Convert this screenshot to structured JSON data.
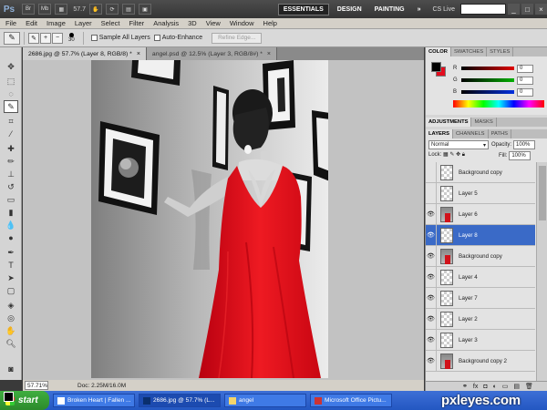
{
  "app": {
    "logo": "Ps",
    "bar_buttons": [
      "Br",
      "Mb"
    ],
    "zoom": "57.7",
    "workspaces": [
      "ESSENTIALS",
      "DESIGN",
      "PAINTING"
    ],
    "more": "»",
    "cs_live": "CS Live",
    "window_controls": [
      "_",
      "□",
      "×"
    ]
  },
  "menu": [
    "File",
    "Edit",
    "Image",
    "Layer",
    "Select",
    "Filter",
    "Analysis",
    "3D",
    "View",
    "Window",
    "Help"
  ],
  "options": {
    "brush_size": "30",
    "sample_all_layers": "Sample All Layers",
    "auto_enhance": "Auto-Enhance",
    "refine_edge": "Refine Edge..."
  },
  "documents": {
    "tabs": [
      {
        "label": "2686.jpg @ 57.7% (Layer 8, RGB/8) *",
        "close": "×"
      },
      {
        "label": "angel.psd @ 12.5% (Layer 3, RGB/8#) *",
        "close": "×"
      }
    ]
  },
  "status": {
    "zoom": "57.71%",
    "doc": "Doc: 2.25M/16.0M"
  },
  "color_panel": {
    "tabs": [
      "COLOR",
      "SWATCHES",
      "STYLES"
    ],
    "sliders": [
      {
        "label": "R",
        "value": "0",
        "color": "#e00000"
      },
      {
        "label": "G",
        "value": "0",
        "color": "#00b000"
      },
      {
        "label": "B",
        "value": "0",
        "color": "#0030e0"
      }
    ],
    "foreground": "#000000",
    "background": "#e40c1e"
  },
  "adjustments": {
    "tabs": [
      "ADJUSTMENTS",
      "MASKS"
    ]
  },
  "layers": {
    "tabs": [
      "LAYERS",
      "CHANNELS",
      "PATHS"
    ],
    "blend_mode": "Normal",
    "opacity_label": "Opacity:",
    "opacity": "100%",
    "lock_label": "Lock:",
    "fill_label": "Fill:",
    "fill": "100%",
    "items": [
      {
        "name": "Background copy",
        "visible": false,
        "thumb": "transparent"
      },
      {
        "name": "Layer 5",
        "visible": false,
        "thumb": "transparent"
      },
      {
        "name": "Layer 6",
        "visible": true,
        "thumb": "photo"
      },
      {
        "name": "Layer 8",
        "visible": true,
        "thumb": "transparent",
        "selected": true
      },
      {
        "name": "Background copy",
        "visible": true,
        "thumb": "photo"
      },
      {
        "name": "Layer 4",
        "visible": true,
        "thumb": "transparent"
      },
      {
        "name": "Layer 7",
        "visible": true,
        "thumb": "transparent"
      },
      {
        "name": "Layer 2",
        "visible": true,
        "thumb": "transparent"
      },
      {
        "name": "Layer 3",
        "visible": true,
        "thumb": "transparent"
      },
      {
        "name": "Background copy 2",
        "visible": true,
        "thumb": "photo"
      }
    ]
  },
  "taskbar": {
    "start": "start",
    "tasks": [
      "Broken Heart | Fallen ...",
      "2686.jpg @ 57.7% (L...",
      "angel",
      "Microsoft Office Pictu..."
    ]
  },
  "watermark": "pxleyes.com"
}
